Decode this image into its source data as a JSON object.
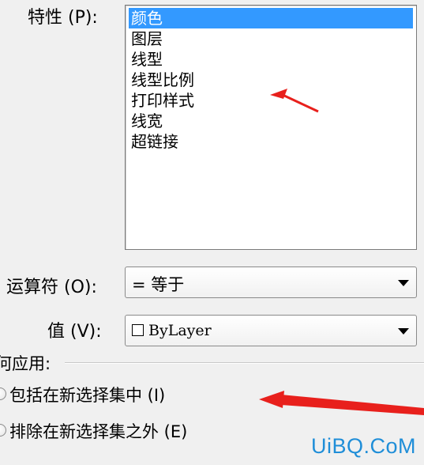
{
  "property": {
    "label": "特性 (P):",
    "items": [
      "颜色",
      "图层",
      "线型",
      "线型比例",
      "打印样式",
      "线宽",
      "超链接"
    ],
    "selected_index": 0
  },
  "operator": {
    "label": "运算符 (O):",
    "value": "= 等于"
  },
  "value_field": {
    "label": "值 (V):",
    "value": "ByLayer"
  },
  "apply_group": {
    "label": "何应用:",
    "include_option": "包括在新选择集中 (I)",
    "exclude_option": "排除在新选择集之外 (E)"
  },
  "watermark": "UiBQ.CoM",
  "colors": {
    "selection": "#3399ff",
    "annotation_arrow": "#e8201c",
    "watermark": "#1f8ed8"
  }
}
